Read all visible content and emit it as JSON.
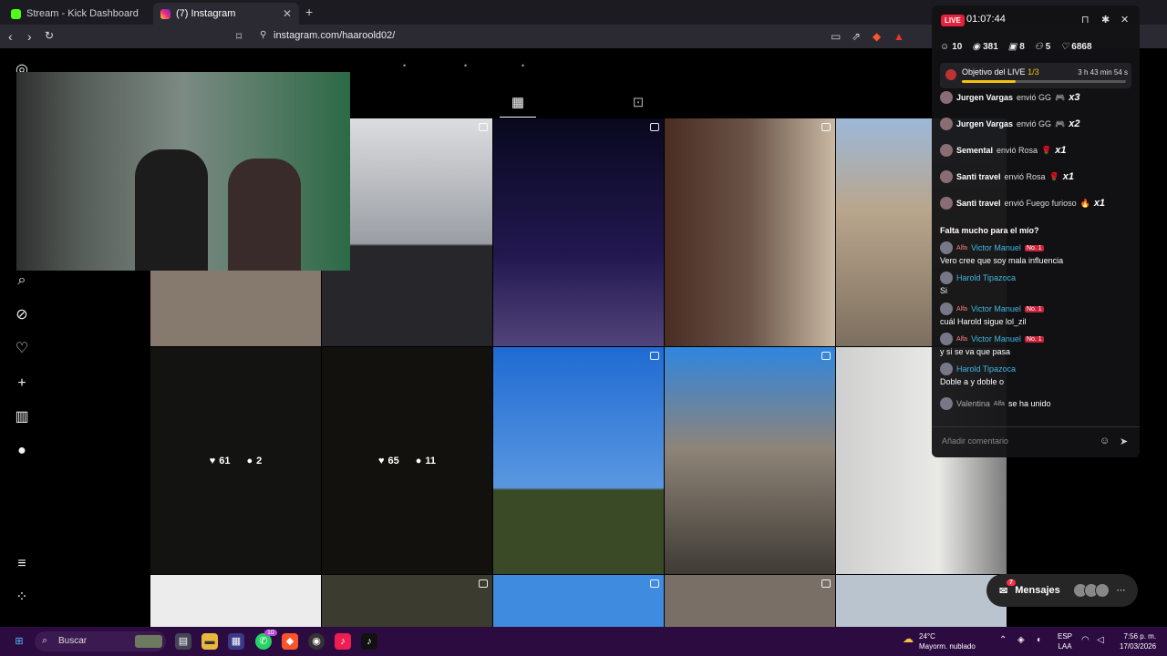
{
  "browser": {
    "tabs": [
      {
        "label": "Stream - Kick Dashboard"
      },
      {
        "label": "(7) Instagram"
      }
    ],
    "url": "instagram.com/haaroold02/"
  },
  "instagram": {
    "posts": [
      {
        "likes": "61",
        "comments": "2"
      },
      {
        "likes": "65",
        "comments": "11"
      }
    ],
    "messages": {
      "label": "Mensajes",
      "count": "7"
    }
  },
  "live": {
    "badge": "LIVE",
    "timer": "01:07:44",
    "stats": {
      "users": "10",
      "viewers": "381",
      "gifts": "8",
      "follows": "5",
      "likes": "6868"
    },
    "goal": {
      "title": "Objetivo del LIVE",
      "progress": "1/3",
      "remaining": "3 h 43 min 54 s",
      "fraction": 0.33
    },
    "gifts": [
      {
        "user": "Jurgen Vargas",
        "action": "envió GG",
        "mult": "x3"
      },
      {
        "user": "Jurgen Vargas",
        "action": "envió GG",
        "mult": "x2"
      },
      {
        "user": "Semental",
        "action": "envió Rosa",
        "mult": "x1"
      },
      {
        "user": "Santi travel",
        "action": "envió Rosa",
        "mult": "x1"
      },
      {
        "user": "Santi travel",
        "action": "envió Fuego furioso",
        "mult": "x1"
      }
    ],
    "chat": [
      {
        "user": "",
        "message": "Falta mucho para el mío?"
      },
      {
        "user": "Victor Manuel",
        "badge": "Alfa",
        "rank": "No. 1",
        "message": "Vero cree que soy mala influencia"
      },
      {
        "user": "Harold Tipazoca",
        "message": "Si"
      },
      {
        "user": "Victor Manuel",
        "badge": "Alfa",
        "rank": "No. 1",
        "message": "cuál Harold sigue lol_zil"
      },
      {
        "user": "Victor Manuel",
        "badge": "Alfa",
        "rank": "No. 1",
        "message": "y si se va que pasa"
      },
      {
        "user": "Harold Tipazoca",
        "message": "Doble a y doble o"
      }
    ],
    "join": {
      "user": "Valentina",
      "badge": "Alfa",
      "text": "se ha unido"
    },
    "comment_placeholder": "Añadir comentario"
  },
  "taskbar": {
    "search": "Buscar",
    "badge": "10",
    "weather": {
      "temp": "24°C",
      "desc": "Mayorm. nublado"
    },
    "lang": {
      "a": "ESP",
      "b": "LAA"
    },
    "clock": {
      "time": "7:56 p. m.",
      "date": "17/03/2026"
    }
  }
}
